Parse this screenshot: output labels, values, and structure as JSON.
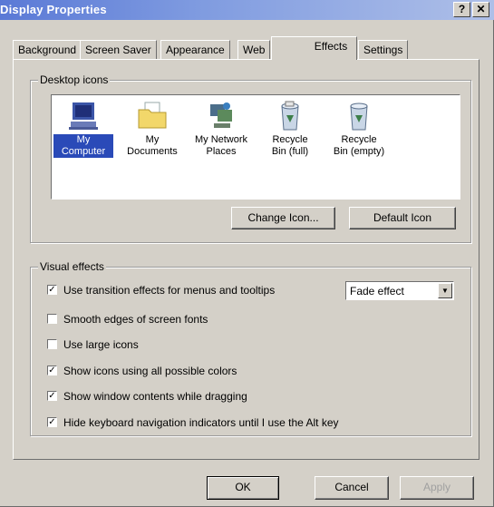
{
  "window": {
    "title": "Display Properties",
    "help_glyph": "?",
    "close_glyph": "✕"
  },
  "tabs": [
    {
      "label": "Background"
    },
    {
      "label": "Screen Saver"
    },
    {
      "label": "Appearance"
    },
    {
      "label": "Web"
    },
    {
      "label": "Effects",
      "active": true
    },
    {
      "label": "Settings"
    }
  ],
  "desktop_icons": {
    "group_label": "Desktop icons",
    "items": [
      {
        "label_line1": "My",
        "label_line2": "Computer",
        "icon": "my-computer-icon",
        "selected": true
      },
      {
        "label_line1": "My",
        "label_line2": "Documents",
        "icon": "my-documents-icon",
        "selected": false
      },
      {
        "label_line1": "My Network",
        "label_line2": "Places",
        "icon": "network-places-icon",
        "selected": false
      },
      {
        "label_line1": "Recycle",
        "label_line2": "Bin (full)",
        "icon": "recycle-bin-full-icon",
        "selected": false
      },
      {
        "label_line1": "Recycle",
        "label_line2": "Bin (empty)",
        "icon": "recycle-bin-empty-icon",
        "selected": false
      }
    ],
    "change_icon_label": "Change Icon...",
    "default_icon_label": "Default Icon"
  },
  "visual_effects": {
    "group_label": "Visual effects",
    "options": [
      {
        "label": "Use transition effects for menus and tooltips",
        "checked": true
      },
      {
        "label": "Smooth edges of screen fonts",
        "checked": false
      },
      {
        "label": "Use large icons",
        "checked": false
      },
      {
        "label": "Show icons using all possible colors",
        "checked": true
      },
      {
        "label": "Show window contents while dragging",
        "checked": true
      },
      {
        "label": "Hide keyboard navigation indicators until I use the Alt key",
        "checked": true
      }
    ],
    "transition_effect": "Fade effect"
  },
  "buttons": {
    "ok": "OK",
    "cancel": "Cancel",
    "apply": "Apply"
  },
  "colors": {
    "titlebar_start": "#5a79d6",
    "selection": "#2a4ab8",
    "face": "#d4d0c8"
  }
}
